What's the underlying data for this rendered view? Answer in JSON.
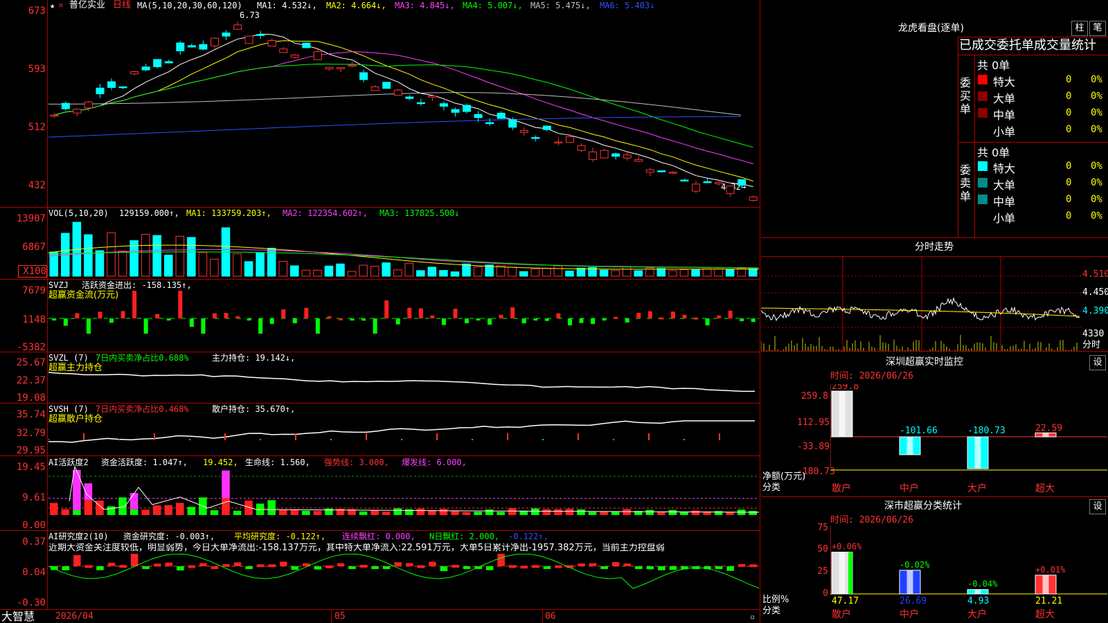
{
  "stock": {
    "name": "普亿实业",
    "period": "日线",
    "ma_label": "MA(5,10,20,30,60,120)",
    "ma1": "MA1: 4.532↓,",
    "ma2": "MA2: 4.664↓,",
    "ma3": "MA3: 4.845↓,",
    "ma4": "MA4: 5.007↓,",
    "ma5": "MA5: 5.475↓,",
    "ma6": "MA6: 5.403↓",
    "high_label": "6.73",
    "low_label": "4.32→"
  },
  "price_axis": [
    "673",
    "593",
    "512",
    "432"
  ],
  "volume": {
    "label": "VOL(5,10,20)",
    "value": "129159.000↑,",
    "ma1": "MA1: 133759.203↑,",
    "ma2": "MA2: 122354.602↑,",
    "ma3": "MA3: 137825.500↓",
    "axis": [
      "13907",
      "6867",
      "X100"
    ]
  },
  "svzj": {
    "label": "SVZJ",
    "desc": "活跃资金进出: -158.135↑,",
    "title": "超赢资金流(万元)",
    "axis": [
      "7679",
      "1148",
      "-5382"
    ]
  },
  "svzl": {
    "label": "SVZL (7)",
    "desc": "7日内买卖净占比0.688%",
    "value": "主力持仓: 19.142↓,",
    "title": "超赢主力持仓",
    "axis": [
      "25.67",
      "22.37",
      "19.08"
    ]
  },
  "svsh": {
    "label": "SVSH (7)",
    "desc": "7日内买卖净占比0.468%",
    "value": "散户持仓: 35.670↑,",
    "title": "超赢散户持仓",
    "axis": [
      "35.74",
      "32.79",
      "29.95"
    ]
  },
  "ai1": {
    "label": "AI活跃度2",
    "v1": "资金活跃度: 1.047↑,",
    "v2": "19.452,",
    "v3": "生命线: 1.560,",
    "v4": "强势线: 3.000,",
    "v5": "爆发线: 6.000,",
    "axis": [
      "19.45",
      "9.61",
      "0.00"
    ]
  },
  "ai2": {
    "label": "AI研究度2(10)",
    "v1": "资金研究度: -0.003↑,",
    "v2": "平均研究度: -0.122↑,",
    "v3": "连续飘红: 0.000,",
    "v4": "N日飘红: 2.000,",
    "v5": "-0.122↑,",
    "comment": "近期大资金关注度较低，明显弱势，今日大单净流出:-158.137万元，其中特大单净流入:22.591万元，大单5日累计净出-1957.382万元，当前主力控盘弱",
    "axis": [
      "0.37",
      "0.04",
      "-0.30"
    ]
  },
  "bottom": {
    "brand": "大智慧",
    "dates": [
      "2026/04",
      "05",
      "06"
    ]
  },
  "lhb": {
    "title": "龙虎看盘(逐单)",
    "btn1": "柱",
    "btn2": "笔",
    "header": "已成交委托单成交量统计",
    "buy_side": "委买单",
    "sell_side": "委卖单",
    "count_buy": "共 0单",
    "count_sell": "共 0单",
    "rows": [
      {
        "label": "特大",
        "num": "0",
        "pct": "0%"
      },
      {
        "label": "大单",
        "num": "0",
        "pct": "0%"
      },
      {
        "label": "中单",
        "num": "0",
        "pct": "0%"
      },
      {
        "label": "小单",
        "num": "0",
        "pct": "0%"
      }
    ],
    "buy_colors": [
      "#ff0000",
      "#8b0000",
      "#8b0000",
      "#000000"
    ],
    "sell_colors": [
      "#00ffff",
      "#008b8b",
      "#008b8b",
      "#000000"
    ]
  },
  "fenshi": {
    "title": "分时走势",
    "axis": [
      "4.510",
      "4.450",
      "4.390",
      "4330"
    ],
    "unit": "分时"
  },
  "monitor": {
    "title": "深圳超赢实时监控",
    "btn": "设",
    "time": "时间: 2026/06/26",
    "axis": [
      "259.8",
      "112.95",
      "-33.89",
      "-180.73"
    ],
    "ylabel": "净额(万元)",
    "xlabel": "分类",
    "values": [
      "259.8",
      "-101.66",
      "-180.73",
      "22.59"
    ],
    "cats": [
      "散户",
      "中户",
      "大户",
      "超大"
    ]
  },
  "classify": {
    "title": "深市超赢分类统计",
    "btn": "设",
    "time": "时间: 2026/06/26",
    "axis": [
      "75",
      "50",
      "25",
      "0"
    ],
    "ylabel": "比例%",
    "xlabel": "分类",
    "pcts": [
      "+0.06%",
      "-0.02%",
      "-0.04%",
      "+0.01%"
    ],
    "values": [
      "47.17",
      "26.69",
      "4.93",
      "21.21"
    ],
    "cats": [
      "散户",
      "中户",
      "大户",
      "超大"
    ]
  }
}
